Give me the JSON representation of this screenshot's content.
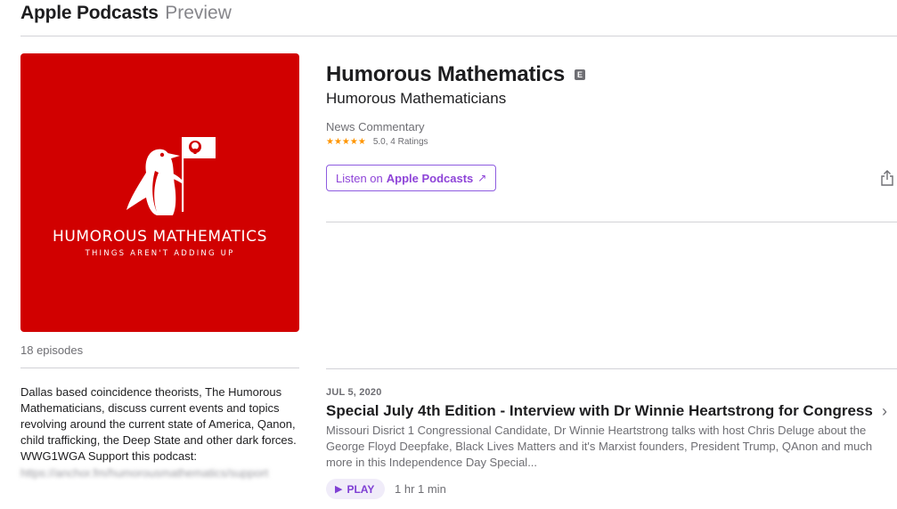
{
  "header": {
    "brand": "Apple Podcasts",
    "brand_sub": "Preview"
  },
  "artwork": {
    "title": "HUMOROUS MATHEMATICS",
    "tagline": "THINGS AREN'T ADDING UP",
    "background_color": "#d10000"
  },
  "podcast": {
    "title": "Humorous Mathematics",
    "explicit_badge": "E",
    "author": "Humorous Mathematicians",
    "category": "News Commentary",
    "stars": "★★★★★",
    "rating_text": "5.0, 4 Ratings",
    "listen_prefix": "Listen on",
    "listen_strong": "Apple Podcasts",
    "listen_arrow": "↗"
  },
  "sidebar": {
    "episode_count": "18 episodes",
    "description": "Dallas based coincidence theorists, The Humorous Mathematicians, discuss current events and topics revolving around the current state of America, Qanon, child trafficking, the Deep State and other dark forces. WWG1WGA Support this podcast:",
    "support_link": "https://anchor.fm/humorousmathematics/support"
  },
  "episode": {
    "date": "JUL 5, 2020",
    "title": "Special July 4th Edition - Interview with Dr Winnie Heartstrong for Congress",
    "description": "Missouri Disrict 1 Congressional Candidate, Dr Winnie Heartstrong talks with host Chris Deluge about the George Floyd Deepfake, Black Lives Matters and it's Marxist founders, President Trump, QAnon and much more in this Independence Day Special...",
    "play_label": "PLAY",
    "duration": "1 hr 1 min"
  },
  "colors": {
    "accent": "#8e44d8",
    "star": "#ff9500",
    "muted": "#6e6e73"
  }
}
